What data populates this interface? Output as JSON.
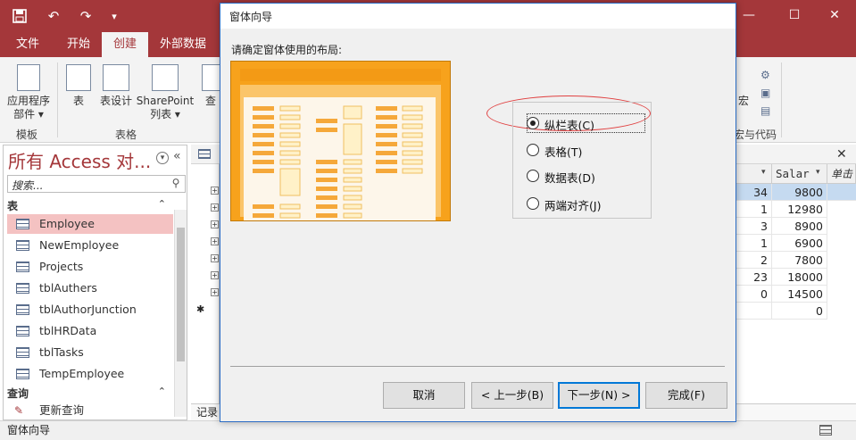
{
  "titlebar": {
    "icons": [
      "save-icon",
      "undo-icon",
      "redo-icon",
      "customize-icon"
    ]
  },
  "tabs": [
    "文件",
    "开始",
    "创建",
    "外部数据"
  ],
  "ribbon": {
    "buttons": [
      {
        "label": "应用程序\n部件 ▾",
        "icon": "app-parts-icon"
      },
      {
        "label": "表",
        "icon": "table-icon"
      },
      {
        "label": "表设计",
        "icon": "table-design-icon"
      },
      {
        "label": "SharePoint\n列表 ▾",
        "icon": "sharepoint-list-icon"
      },
      {
        "label": "查",
        "icon": "query-icon"
      },
      {
        "label": "宏",
        "icon": "macro-icon"
      }
    ],
    "groups": [
      "模板",
      "表格",
      "宏与代码"
    ]
  },
  "nav": {
    "title": "所有 Access 对...",
    "search_placeholder": "搜索...",
    "sections": [
      {
        "label": "表",
        "chevron": "⌃"
      },
      {
        "label": "查询",
        "chevron": "⌃"
      }
    ],
    "tables": [
      "Employee",
      "NewEmployee",
      "Projects",
      "tblAuthers",
      "tblAuthorJunction",
      "tblHRData",
      "tblTasks",
      "TempEmployee"
    ],
    "queries": [
      "更新查询"
    ]
  },
  "datasheet": {
    "headers": [
      "Salar",
      "单击"
    ],
    "left_col": [
      "34",
      "1",
      "3",
      "1",
      "2",
      "23",
      "0",
      ""
    ],
    "salary": [
      "9800",
      "12980",
      "8900",
      "6900",
      "7800",
      "18000",
      "14500",
      "0"
    ],
    "new_row_marker": "✱",
    "record_label": "记录"
  },
  "dialog": {
    "title": "窗体向导",
    "prompt": "请确定窗体使用的布局:",
    "options": [
      {
        "label": "纵栏表(C)",
        "key": "C",
        "checked": true
      },
      {
        "label": "表格(T)",
        "key": "T",
        "checked": false
      },
      {
        "label": "数据表(D)",
        "key": "D",
        "checked": false
      },
      {
        "label": "两端对齐(J)",
        "key": "J",
        "checked": false
      }
    ],
    "buttons": {
      "cancel": "取消",
      "back": "< 上一步(B)",
      "next": "下一步(N) >",
      "finish": "完成(F)"
    }
  },
  "status": {
    "text": "窗体向导"
  },
  "colors": {
    "accent": "#a4373a",
    "preview_orange": "#f7a21c",
    "highlight": "#f4c2c2",
    "annotation": "#e04040"
  }
}
